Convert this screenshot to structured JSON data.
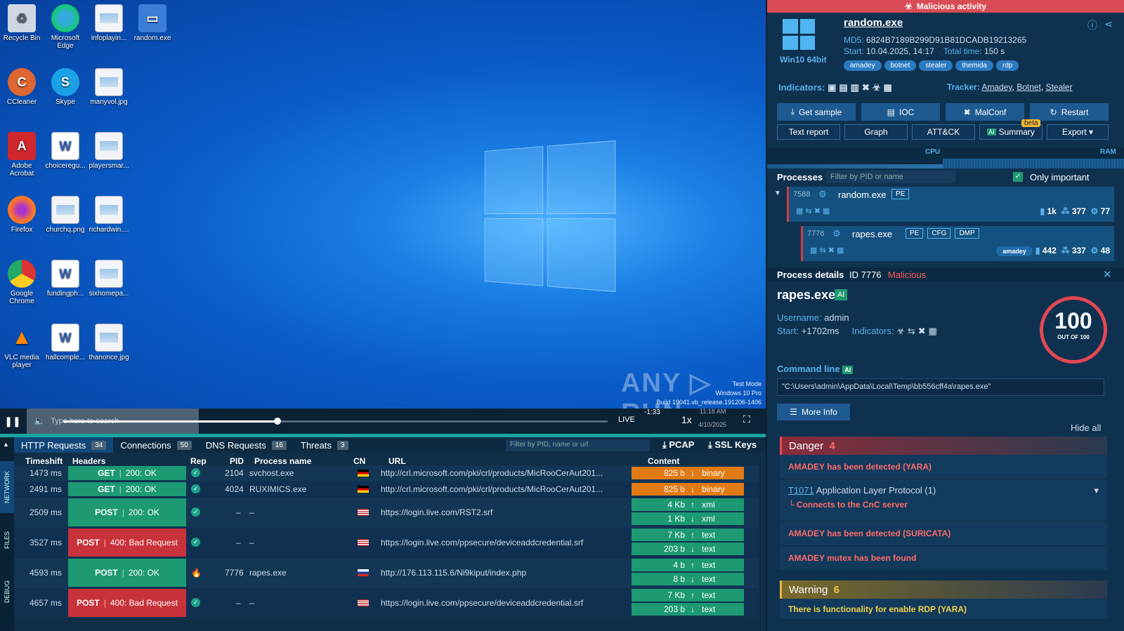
{
  "desktop": {
    "icons": [
      {
        "label": "Recycle Bin",
        "kind": "recycle"
      },
      {
        "label": "Microsoft Edge",
        "kind": "edge"
      },
      {
        "label": "infoplayin...",
        "kind": "doc"
      },
      {
        "label": "random.exe",
        "kind": "exe"
      },
      {
        "label": "CCleaner",
        "kind": "ccleaner"
      },
      {
        "label": "Skype",
        "kind": "skype"
      },
      {
        "label": "manyvol.jpg",
        "kind": "doc"
      },
      {
        "label": "Adobe Acrobat",
        "kind": "acrobat"
      },
      {
        "label": "choiceregu...",
        "kind": "word"
      },
      {
        "label": "playersmar...",
        "kind": "doc"
      },
      {
        "label": "Firefox",
        "kind": "firefox"
      },
      {
        "label": "churchq.png",
        "kind": "doc"
      },
      {
        "label": "richardwin....",
        "kind": "doc"
      },
      {
        "label": "Google Chrome",
        "kind": "chrome"
      },
      {
        "label": "fundingph...",
        "kind": "word"
      },
      {
        "label": "sixhomepa...",
        "kind": "doc"
      },
      {
        "label": "VLC media player",
        "kind": "vlc"
      },
      {
        "label": "hallcomple...",
        "kind": "word"
      },
      {
        "label": "thanonce.jpg",
        "kind": "doc"
      }
    ],
    "watermark": "ANY ▷ RUN",
    "test_mode": [
      "Test Mode",
      "Windows 10 Pro",
      "Build 19041.vb_release.191206-1406"
    ]
  },
  "player": {
    "taskbar_search": "Type here to search",
    "live": "LIVE",
    "time": "-1:33",
    "speed": "1x",
    "clock": "11:18 AM",
    "date": "4/10/2025"
  },
  "network": {
    "side_tabs": [
      "NETWORK",
      "FILES",
      "DEBUG"
    ],
    "tabs": [
      {
        "label": "HTTP Requests",
        "count": "34"
      },
      {
        "label": "Connections",
        "count": "50"
      },
      {
        "label": "DNS Requests",
        "count": "16"
      },
      {
        "label": "Threats",
        "count": "3"
      }
    ],
    "filter_placeholder": "Filter by PID, name or url",
    "pcap": "PCAP",
    "ssl": "SSL Keys",
    "columns": [
      "Timeshift",
      "Headers",
      "Rep",
      "PID",
      "Process name",
      "CN",
      "URL",
      "Content"
    ],
    "rows": [
      {
        "time": "1473 ms",
        "method": "GET",
        "status": "200: OK",
        "rep": "ok",
        "pid": "2104",
        "proc": "svchost.exe",
        "cn": "de",
        "url": "http://crl.microsoft.com/pki/crl/products/MicRooCerAut201...",
        "content": [
          {
            "size": "825 b",
            "dir": "↓",
            "type": "binary"
          }
        ]
      },
      {
        "time": "2491 ms",
        "method": "GET",
        "status": "200: OK",
        "rep": "ok",
        "pid": "4024",
        "proc": "RUXIMICS.exe",
        "cn": "de",
        "url": "http://crl.microsoft.com/pki/crl/products/MicRooCerAut201...",
        "content": [
          {
            "size": "825 b",
            "dir": "↓",
            "type": "binary"
          }
        ]
      },
      {
        "time": "2509 ms",
        "method": "POST",
        "status": "200: OK",
        "rep": "ok",
        "pid": "–",
        "proc": "–",
        "cn": "us",
        "url": "https://login.live.com/RST2.srf",
        "content": [
          {
            "size": "4 Kb",
            "dir": "↑",
            "type": "xml"
          },
          {
            "size": "1 Kb",
            "dir": "↓",
            "type": "xml"
          }
        ]
      },
      {
        "time": "3527 ms",
        "method": "POST",
        "status": "400: Bad Request",
        "rep": "ok",
        "pid": "–",
        "proc": "–",
        "cn": "us",
        "url": "https://login.live.com/ppsecure/deviceaddcredential.srf",
        "content": [
          {
            "size": "7 Kb",
            "dir": "↑",
            "type": "text"
          },
          {
            "size": "203 b",
            "dir": "↓",
            "type": "text"
          }
        ]
      },
      {
        "time": "4593 ms",
        "method": "POST",
        "status": "200: OK",
        "rep": "fire",
        "pid": "7776",
        "proc": "rapes.exe",
        "cn": "ru",
        "url": "http://176.113.115.6/Ni9kiput/index.php",
        "content": [
          {
            "size": "4 b",
            "dir": "↑",
            "type": "text"
          },
          {
            "size": "8 b",
            "dir": "↓",
            "type": "text"
          }
        ]
      },
      {
        "time": "4657 ms",
        "method": "POST",
        "status": "400: Bad Request",
        "rep": "ok",
        "pid": "–",
        "proc": "–",
        "cn": "us",
        "url": "https://login.live.com/ppsecure/deviceaddcredential.srf",
        "content": [
          {
            "size": "7 Kb",
            "dir": "↑",
            "type": "text"
          },
          {
            "size": "203 b",
            "dir": "↓",
            "type": "text"
          }
        ]
      }
    ]
  },
  "panel": {
    "banner": "Malicious activity",
    "os": "Win10 64bit",
    "filename": "random.exe",
    "md5_label": "MD5:",
    "md5": "6824B7189B299D91B81DCADB19213265",
    "start_label": "Start:",
    "start": "10.04.2025, 14:17",
    "total_label": "Total time:",
    "total": "150 s",
    "tags": [
      "amadey",
      "botnet",
      "stealer",
      "themida",
      "rdp"
    ],
    "indicators_label": "Indicators:",
    "tracker_label": "Tracker:",
    "trackers": [
      "Amadey",
      "Botnet",
      "Stealer"
    ],
    "buttons1": [
      "Get sample",
      "IOC",
      "MalConf",
      "Restart"
    ],
    "buttons2": [
      "Text report",
      "Graph",
      "ATT&CK",
      "Summary",
      "Export ▾"
    ],
    "beta": "beta",
    "ai": "AI",
    "cpu": "CPU",
    "ram": "RAM",
    "processes_label": "Processes",
    "proc_filter": "Filter by PID or name",
    "only_important": "Only important",
    "procs": [
      {
        "pid": "7588",
        "name": "random.exe",
        "tags": [
          "PE"
        ],
        "files": "1k",
        "reg": "377",
        "mods": "77",
        "family": ""
      },
      {
        "pid": "7776",
        "name": "rapes.exe",
        "tags": [
          "PE",
          "CFG",
          "DMP"
        ],
        "files": "442",
        "reg": "337",
        "mods": "48",
        "family": "amadey"
      }
    ],
    "details_label": "Process details",
    "details_id": "ID 7776",
    "details_verdict": "Malicious",
    "proc_name": "rapes.exe",
    "username_label": "Username:",
    "username": "admin",
    "pstart_label": "Start:",
    "pstart": "+1702ms",
    "pind_label": "Indicators:",
    "score": "100",
    "score_sub": "OUT OF 100",
    "cmd_label": "Command line",
    "cmd": "\"C:\\Users\\admin\\AppData\\Local\\Temp\\bb556cff4a\\rapes.exe\"",
    "more_info": "More Info",
    "hide_all": "Hide all",
    "danger_label": "Danger",
    "danger_count": "4",
    "danger_items": [
      "AMADEY has been detected (YARA)",
      "AMADEY has been detected (SURICATA)",
      "AMADEY mutex has been found"
    ],
    "technique_id": "T1071",
    "technique_name": "Application Layer Protocol (1)",
    "technique_sub": "Connects to the CnC server",
    "warning_label": "Warning",
    "warning_count": "6",
    "warning_item": "There is functionality for enable RDP (YARA)"
  }
}
